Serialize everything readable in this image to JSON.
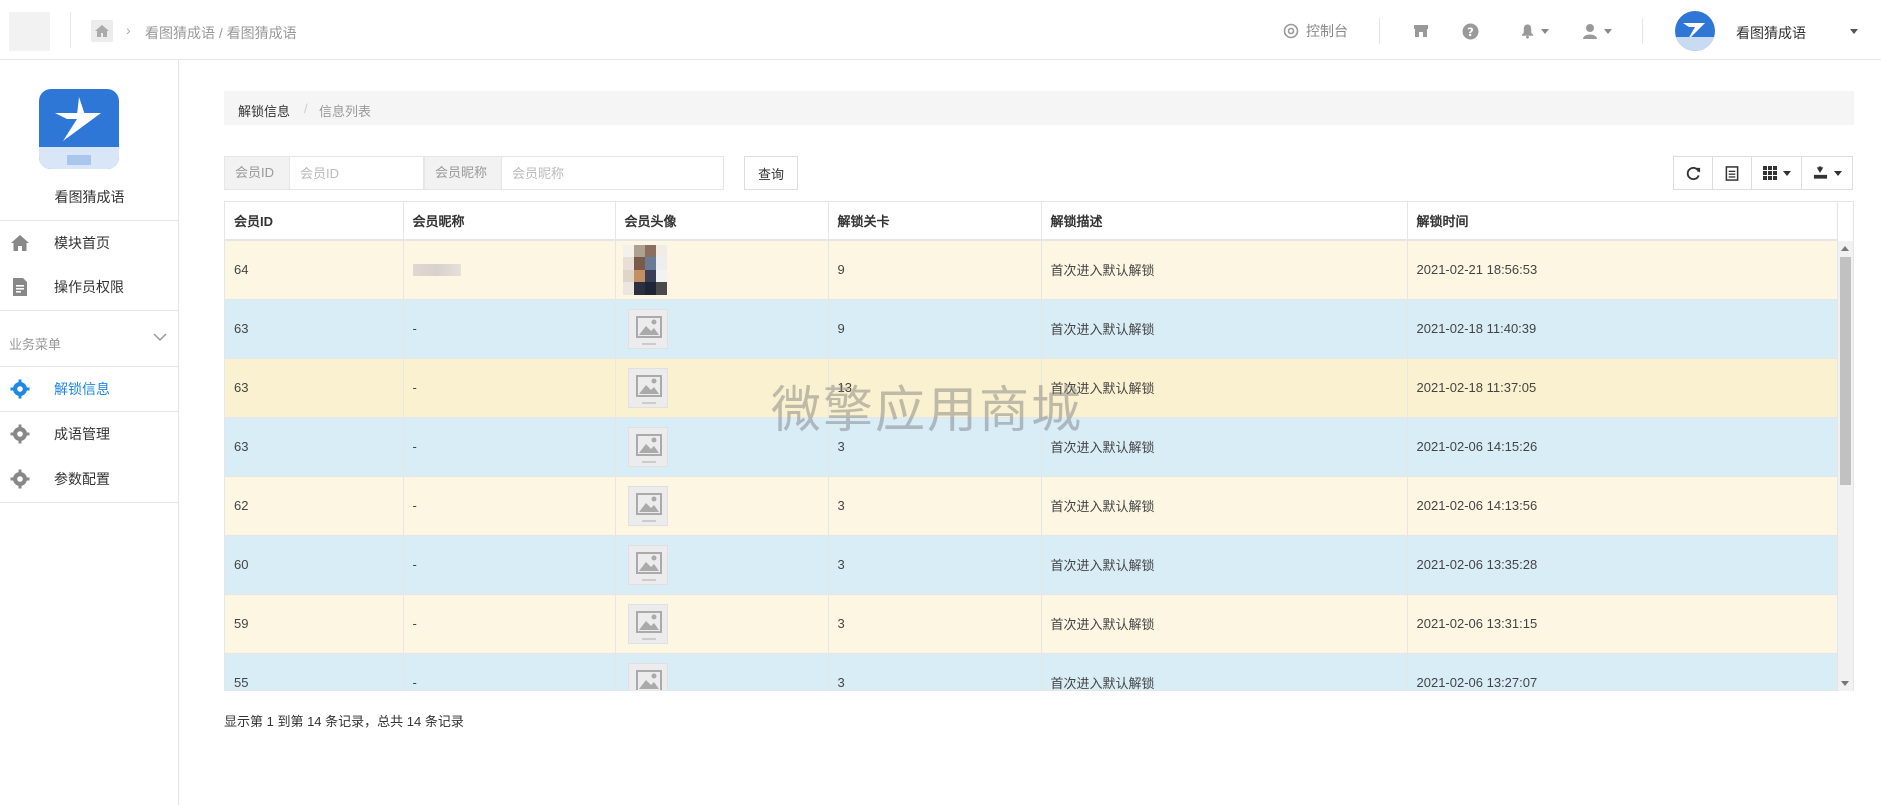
{
  "topbar": {
    "breadcrumb": "看图猜成语 / 看图猜成语",
    "console_label": "控制台",
    "user_name": "看图猜成语"
  },
  "sidebar": {
    "app_name": "看图猜成语",
    "items": [
      {
        "label": "模块首页",
        "icon": "home-icon"
      },
      {
        "label": "操作员权限",
        "icon": "document-icon"
      }
    ],
    "group_title": "业务菜单",
    "group_items": [
      {
        "label": "解锁信息",
        "icon": "gear-icon",
        "active": true
      },
      {
        "label": "成语管理",
        "icon": "gear-icon",
        "active": false
      },
      {
        "label": "参数配置",
        "icon": "gear-icon",
        "active": false
      }
    ]
  },
  "breadcrumb": {
    "level1": "解锁信息",
    "separator": "/",
    "level2": "信息列表"
  },
  "search": {
    "member_id_label": "会员ID",
    "member_id_placeholder": "会员ID",
    "nickname_label": "会员昵称",
    "nickname_placeholder": "会员昵称",
    "query_label": "查询"
  },
  "table": {
    "columns": [
      "会员ID",
      "会员昵称",
      "会员头像",
      "解锁关卡",
      "解锁描述",
      "解锁时间"
    ],
    "rows": [
      {
        "id": "64",
        "nickname": "",
        "level": "9",
        "desc": "首次进入默认解锁",
        "time": "2021-02-21 18:56:53"
      },
      {
        "id": "63",
        "nickname": "-",
        "level": "9",
        "desc": "首次进入默认解锁",
        "time": "2021-02-18 11:40:39"
      },
      {
        "id": "63",
        "nickname": "-",
        "level": "13",
        "desc": "首次进入默认解锁",
        "time": "2021-02-18 11:37:05"
      },
      {
        "id": "63",
        "nickname": "-",
        "level": "3",
        "desc": "首次进入默认解锁",
        "time": "2021-02-06 14:15:26"
      },
      {
        "id": "62",
        "nickname": "-",
        "level": "3",
        "desc": "首次进入默认解锁",
        "time": "2021-02-06 14:13:56"
      },
      {
        "id": "60",
        "nickname": "-",
        "level": "3",
        "desc": "首次进入默认解锁",
        "time": "2021-02-06 13:35:28"
      },
      {
        "id": "59",
        "nickname": "-",
        "level": "3",
        "desc": "首次进入默认解锁",
        "time": "2021-02-06 13:31:15"
      },
      {
        "id": "55",
        "nickname": "-",
        "level": "3",
        "desc": "首次进入默认解锁",
        "time": "2021-02-06 13:27:07"
      }
    ]
  },
  "watermark": "微擎应用商城",
  "pager_info": "显示第 1 到第 14 条记录，总共 14 条记录",
  "colors": {
    "accent": "#1e88e5",
    "row_odd": "#fdf6e3",
    "row_even": "#d9edf7"
  }
}
